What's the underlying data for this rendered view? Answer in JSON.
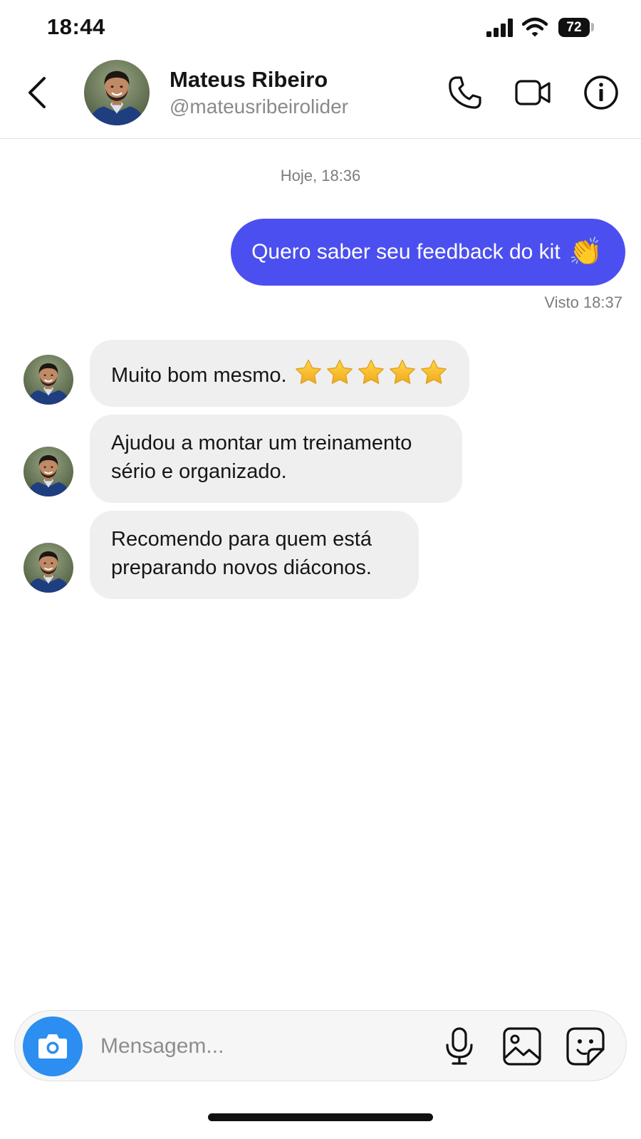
{
  "status_bar": {
    "time": "18:44",
    "battery": "72",
    "icons": [
      "signal-icon",
      "wifi-icon",
      "battery-icon"
    ]
  },
  "header": {
    "name": "Mateus Ribeiro",
    "handle": "@mateusribeirolider",
    "icons": [
      "back-arrow-icon",
      "avatar",
      "phone-icon",
      "video-icon",
      "info-icon"
    ]
  },
  "conversation": {
    "date_separator": "Hoje, 18:36",
    "outgoing": {
      "text": "Quero saber seu feedback do kit",
      "emoji": "👏",
      "seen": "Visto 18:37"
    },
    "incoming": [
      {
        "text": "Muito bom mesmo.",
        "stars": 5
      },
      {
        "text": "Ajudou a montar um treinamento sério e organizado."
      },
      {
        "text": "Recomendo para quem está preparando novos diáconos."
      }
    ]
  },
  "composer": {
    "placeholder": "Mensagem...",
    "icons": [
      "camera-icon",
      "microphone-icon",
      "gallery-icon",
      "sticker-icon"
    ]
  },
  "colors": {
    "outgoing_bubble": "#4b4ff0",
    "incoming_bubble": "#efefef",
    "camera_button": "#2b8ef0",
    "star": "#f7c325"
  }
}
